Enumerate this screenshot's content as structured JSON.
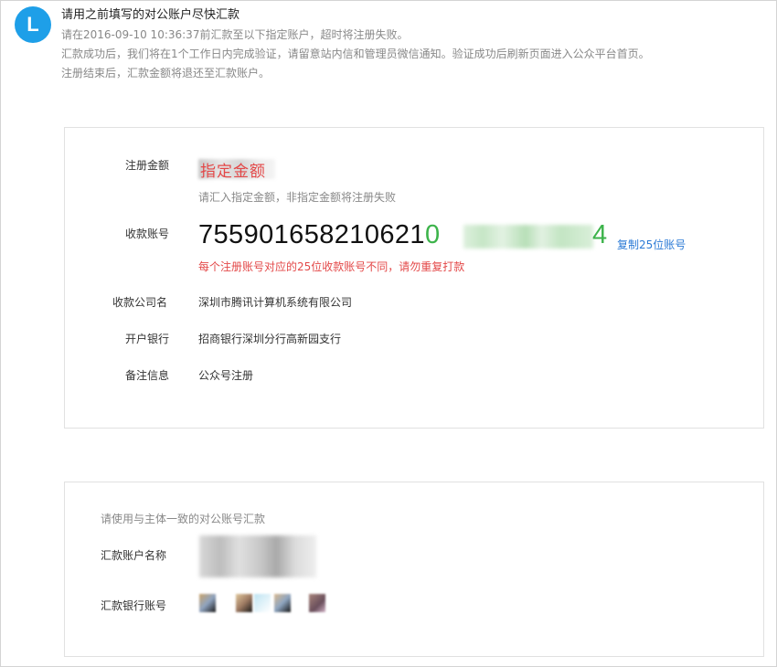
{
  "notice": {
    "avatar_letter": "L",
    "title": "请用之前填写的对公账户尽快汇款",
    "line1": "请在2016-09-10 10:36:37前汇款至以下指定账户，超时将注册失败。",
    "line2": "汇款成功后，我们将在1个工作日内完成验证，请留意站内信和管理员微信通知。验证成功后刷新页面进入公众平台首页。",
    "line3": "注册结束后，汇款金额将退还至汇款账户。"
  },
  "payment": {
    "amount_label": "注册金额",
    "amount_value": "指定金额",
    "amount_hint": "请汇入指定金额，非指定金额将注册失败",
    "account_label": "收款账号",
    "account_prefix": "755901658210621",
    "account_mid": "0",
    "account_last": "4",
    "copy_link": "复制25位账号",
    "account_warning": "每个注册账号对应的25位收款账号不同，请勿重复打款",
    "company_label": "收款公司名",
    "company_value": "深圳市腾讯计算机系统有限公司",
    "bank_label": "开户银行",
    "bank_value": "招商银行深圳分行高新园支行",
    "remark_label": "备注信息",
    "remark_value": "公众号注册"
  },
  "remitter": {
    "title": "请使用与主体一致的对公账号汇款",
    "name_label": "汇款账户名称",
    "account_label": "汇款银行账号"
  },
  "colors": {
    "accent_blue": "#1e9fe8",
    "link_blue": "#2b7ad6",
    "warning_red": "#e34848",
    "account_green": "#3cb34a"
  }
}
